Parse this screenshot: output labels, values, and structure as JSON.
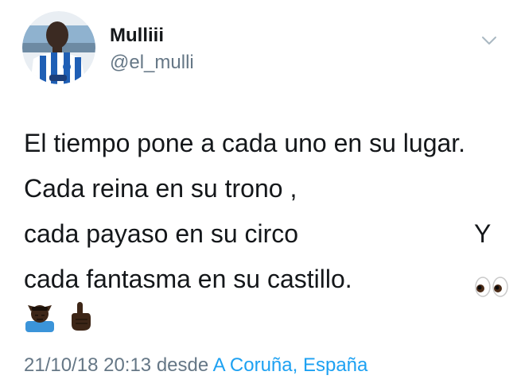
{
  "user": {
    "display_name": "Mulliii",
    "handle": "@el_mulli"
  },
  "tweet": {
    "lines": [
      "El tiempo pone a cada uno en su lugar.",
      "Cada reina en su trono ,",
      "cada payaso en su circo",
      "cada fantasma en su castillo."
    ],
    "line3_suffix": "Y",
    "line4_emoji": "eyes-emoji",
    "trailing_emojis": [
      "man-raising-hand-emoji",
      "index-pointing-up-emoji"
    ]
  },
  "meta": {
    "timestamp": "21/10/18 20:13",
    "source_word": "desde",
    "location": "A Coruña, España"
  },
  "colors": {
    "text": "#14171a",
    "secondary": "#657786",
    "link": "#1da1f2"
  },
  "icons": {
    "menu": "chevron-down-icon"
  }
}
